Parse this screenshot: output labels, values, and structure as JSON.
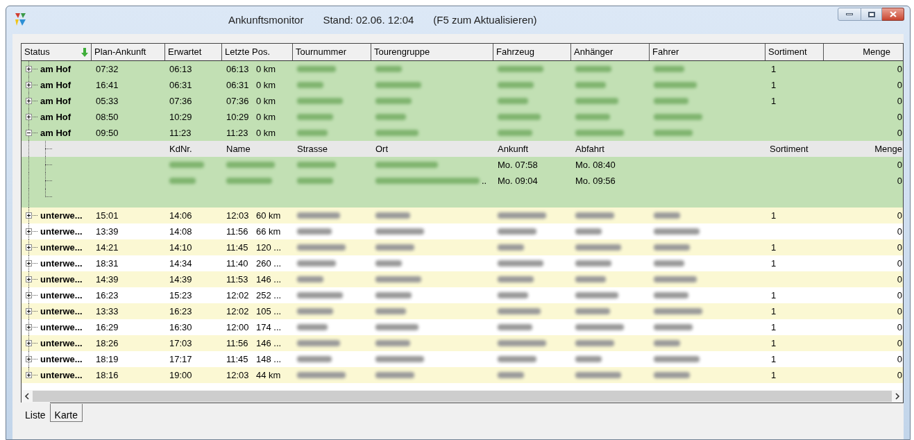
{
  "window": {
    "title": "Ankunftsmonitor",
    "stand": "Stand: 02.06. 12:04",
    "hint": "(F5 zum Aktualisieren)"
  },
  "columns": [
    {
      "label": "Status",
      "sorted": true
    },
    {
      "label": "Plan-Ankunft",
      "sorted": false
    },
    {
      "label": "Erwartet",
      "sorted": false
    },
    {
      "label": "Letzte Pos.",
      "sorted": false
    },
    {
      "label": "Tournummer",
      "sorted": false
    },
    {
      "label": "Tourengruppe",
      "sorted": false
    },
    {
      "label": "Fahrzeug",
      "sorted": false
    },
    {
      "label": "Anhänger",
      "sorted": false
    },
    {
      "label": "Fahrer",
      "sorted": false
    },
    {
      "label": "Sortiment",
      "sorted": false
    },
    {
      "label": "Menge",
      "sorted": false
    }
  ],
  "rows": [
    {
      "status": "am Hof",
      "plan": "07:32",
      "expected": "06:13",
      "pos_time": "06:13",
      "pos_dist": "0 km",
      "sortiment": "1",
      "menge": "0",
      "color": "#c2e0b4",
      "expanded": false
    },
    {
      "status": "am Hof",
      "plan": "16:41",
      "expected": "06:31",
      "pos_time": "06:31",
      "pos_dist": "0 km",
      "sortiment": "1",
      "menge": "0",
      "color": "#c2e0b4",
      "expanded": false
    },
    {
      "status": "am Hof",
      "plan": "05:33",
      "expected": "07:36",
      "pos_time": "07:36",
      "pos_dist": "0 km",
      "sortiment": "1",
      "menge": "0",
      "color": "#c2e0b4",
      "expanded": false
    },
    {
      "status": "am Hof",
      "plan": "08:50",
      "expected": "10:29",
      "pos_time": "10:29",
      "pos_dist": "0 km",
      "menge": "0",
      "color": "#c2e0b4",
      "expanded": false
    },
    {
      "status": "am Hof",
      "plan": "09:50",
      "expected": "11:23",
      "pos_time": "11:23",
      "pos_dist": "0 km",
      "menge": "0",
      "color": "#c2e0b4",
      "expanded": true,
      "detail": {
        "columns": [
          "KdNr.",
          "Name",
          "Strasse",
          "Ort",
          "Ankunft",
          "Abfahrt",
          "Sortiment",
          "Menge"
        ],
        "children": [
          {
            "ankunft": "Mo. 07:58",
            "abfahrt": "Mo. 08:40",
            "menge": "0"
          },
          {
            "ort_tail": "..",
            "ankunft": "Mo. 09:04",
            "abfahrt": "Mo. 09:56",
            "menge": "0"
          }
        ]
      }
    },
    {
      "status": "unterwe...",
      "plan": "15:01",
      "expected": "14:06",
      "pos_time": "12:03",
      "pos_dist": "60 km",
      "sortiment": "1",
      "menge": "0",
      "color": "#fbf8d3",
      "expanded": false
    },
    {
      "status": "unterwe...",
      "plan": "13:39",
      "expected": "14:08",
      "pos_time": "11:56",
      "pos_dist": "66 km",
      "menge": "0",
      "color": "#ffffff",
      "expanded": false
    },
    {
      "status": "unterwe...",
      "plan": "14:21",
      "expected": "14:10",
      "pos_time": "11:45",
      "pos_dist": "120 ...",
      "sortiment": "1",
      "menge": "0",
      "color": "#fbf8d3",
      "expanded": false
    },
    {
      "status": "unterwe...",
      "plan": "18:31",
      "expected": "14:34",
      "pos_time": "11:40",
      "pos_dist": "260 ...",
      "sortiment": "1",
      "menge": "0",
      "color": "#ffffff",
      "expanded": false
    },
    {
      "status": "unterwe...",
      "plan": "14:39",
      "expected": "14:39",
      "pos_time": "11:53",
      "pos_dist": "146 ...",
      "menge": "0",
      "color": "#fbf8d3",
      "expanded": false
    },
    {
      "status": "unterwe...",
      "plan": "16:23",
      "expected": "15:23",
      "pos_time": "12:02",
      "pos_dist": "252 ...",
      "sortiment": "1",
      "menge": "0",
      "color": "#ffffff",
      "expanded": false
    },
    {
      "status": "unterwe...",
      "plan": "13:33",
      "expected": "16:23",
      "pos_time": "12:02",
      "pos_dist": "105 ...",
      "sortiment": "1",
      "menge": "0",
      "color": "#fbf8d3",
      "expanded": false
    },
    {
      "status": "unterwe...",
      "plan": "16:29",
      "expected": "16:30",
      "pos_time": "12:00",
      "pos_dist": "174 ...",
      "sortiment": "1",
      "menge": "0",
      "color": "#ffffff",
      "expanded": false
    },
    {
      "status": "unterwe...",
      "plan": "18:26",
      "expected": "17:03",
      "pos_time": "11:56",
      "pos_dist": "146 ...",
      "sortiment": "1",
      "menge": "0",
      "color": "#fbf8d3",
      "expanded": false
    },
    {
      "status": "unterwe...",
      "plan": "18:19",
      "expected": "17:17",
      "pos_time": "11:45",
      "pos_dist": "148 ...",
      "sortiment": "1",
      "menge": "0",
      "color": "#ffffff",
      "expanded": false
    },
    {
      "status": "unterwe...",
      "plan": "18:16",
      "expected": "19:00",
      "pos_time": "12:03",
      "pos_dist": "44 km",
      "sortiment": "1",
      "menge": "0",
      "color": "#fbf8d3",
      "expanded": false
    }
  ],
  "tabs": [
    {
      "label": "Liste",
      "selected": true
    },
    {
      "label": "Karte",
      "selected": false
    }
  ]
}
